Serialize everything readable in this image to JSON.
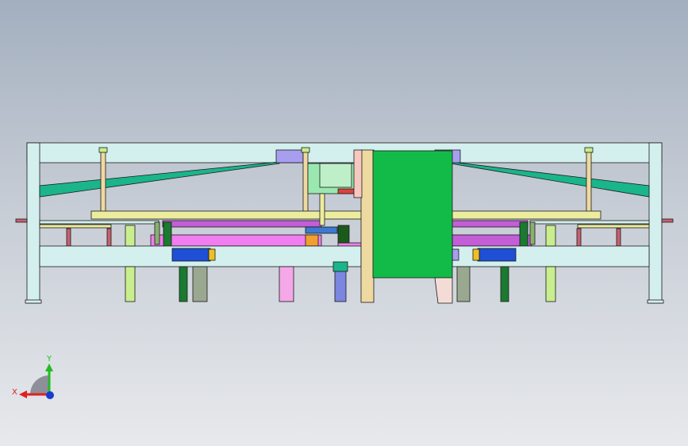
{
  "viewport": {
    "background_top": "#a3afbf",
    "background_bottom": "#e7e9ec"
  },
  "model": {
    "frame_color": "#d4f0ee",
    "brace_color": "#1ab58a",
    "rail_color": "#ecec9e",
    "slide_color": "#f07ef0",
    "slide_dark_color": "#c45ed8",
    "actuator_color": "#1e4fd4",
    "cover_color": "#12bb48",
    "post_color": "#eed9a0",
    "plate_color": "#a89ef0",
    "leg_color": "#c8ee8e"
  },
  "triad": {
    "x_label": "X",
    "y_label": "Y",
    "x_color": "#e02020",
    "y_color": "#22bb22",
    "z_color": "#1a3ad0"
  }
}
